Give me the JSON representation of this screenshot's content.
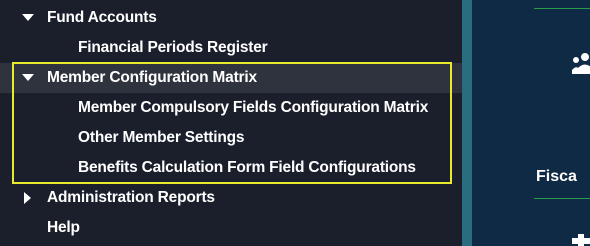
{
  "nav": {
    "items": [
      {
        "label": "Fund Accounts",
        "level": 1,
        "state": "expanded"
      },
      {
        "label": "Financial Periods Register",
        "level": 2
      },
      {
        "label": "Member Configuration Matrix",
        "level": 1,
        "state": "expanded",
        "selected": true
      },
      {
        "label": "Member Compulsory Fields Configuration Matrix",
        "level": 2
      },
      {
        "label": "Other Member Settings",
        "level": 2
      },
      {
        "label": "Benefits Calculation Form Field Configurations",
        "level": 2
      },
      {
        "label": "Administration Reports",
        "level": 1,
        "state": "collapsed"
      },
      {
        "label": "Help",
        "level": 1
      }
    ]
  },
  "right_panel": {
    "partial_title": "Fisca",
    "icons": [
      "users-icon",
      "plus-icon"
    ]
  },
  "colors": {
    "nav_background": "#1a1f2b",
    "selected_row": "#2e333d",
    "highlight_border": "#e8ea2b",
    "divider": "#2a6d80",
    "right_panel_background": "#0f2a44",
    "accent_line": "#2a9a4f",
    "text": "#ffffff"
  }
}
